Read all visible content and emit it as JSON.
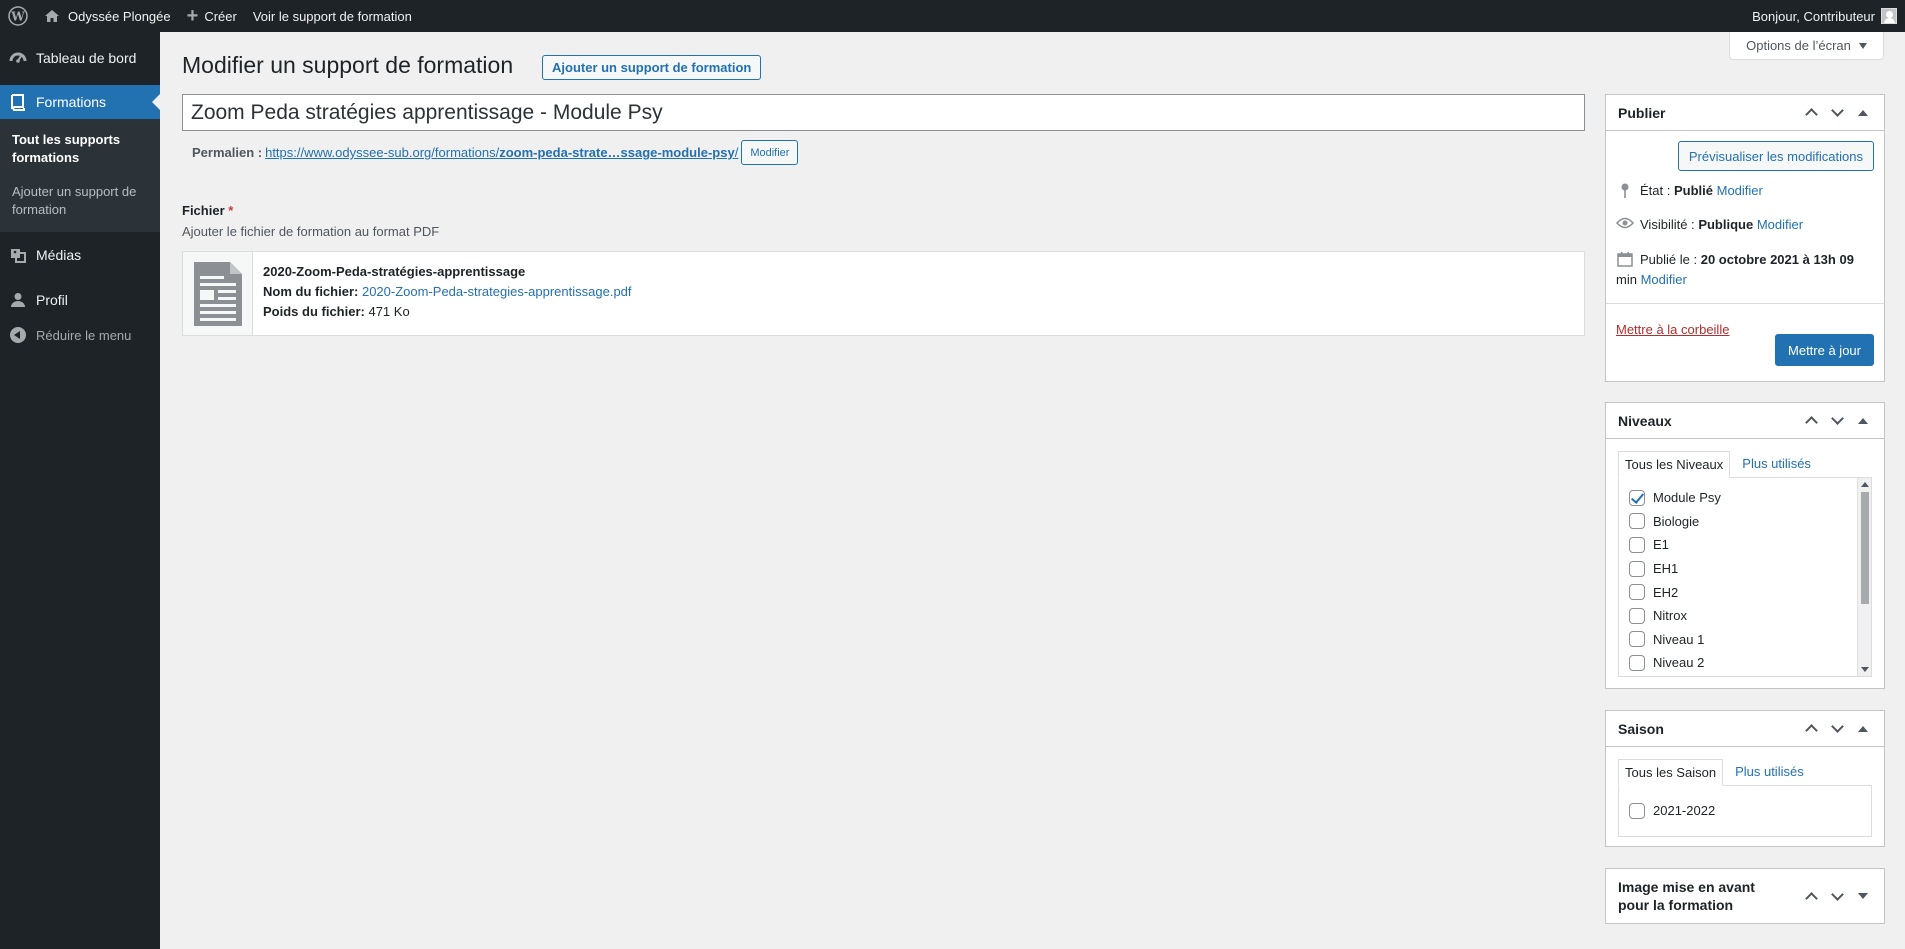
{
  "admin_bar": {
    "site_name": "Odyssée Plongée",
    "new_label": "Créer",
    "view_label": "Voir le support de formation",
    "greeting": "Bonjour, Contributeur"
  },
  "sidebar": {
    "items": [
      {
        "label": "Tableau de bord",
        "icon": "dashboard-icon"
      },
      {
        "label": "Formations",
        "icon": "book-icon"
      },
      {
        "label": "Médias",
        "icon": "media-icon"
      },
      {
        "label": "Profil",
        "icon": "user-icon"
      }
    ],
    "submenu": [
      {
        "label": "Tout les supports formations"
      },
      {
        "label": "Ajouter un support de formation"
      }
    ],
    "collapse_label": "Réduire le menu"
  },
  "screen_options": "Options de l’écran",
  "page": {
    "title": "Modifier un support de formation",
    "add_new": "Ajouter un support de formation",
    "post_title": "Zoom Peda stratégies apprentissage - Module Psy",
    "permalink_label": "Permalien :",
    "permalink_base": "https://www.odyssee-sub.org/formations/",
    "permalink_slug": "zoom-peda-strate…ssage-module-psy",
    "permalink_end": "/",
    "permalink_edit": "Modifier"
  },
  "file_field": {
    "label": "Fichier",
    "required_mark": "*",
    "description": "Ajouter le fichier de formation au format PDF",
    "title": "2020-Zoom-Peda-stratégies-apprentissage",
    "name_label": "Nom du fichier:",
    "name_value": "2020-Zoom-Peda-strategies-apprentissage.pdf",
    "size_label": "Poids du fichier:",
    "size_value": "471 Ko"
  },
  "publish": {
    "title": "Publier",
    "preview": "Prévisualiser les modifications",
    "status_label": "État :",
    "status_value": "Publié",
    "visibility_label": "Visibilité :",
    "visibility_value": "Publique",
    "published_label": "Publié le :",
    "published_value": "20 octobre 2021 à 13h 09",
    "published_value_end": "min",
    "edit": "Modifier",
    "trash": "Mettre à la corbeille",
    "update": "Mettre à jour"
  },
  "niveaux": {
    "title": "Niveaux",
    "tab_all": "Tous les Niveaux",
    "tab_popular": "Plus utilisés",
    "items": [
      {
        "label": "Module Psy",
        "checked": true
      },
      {
        "label": "Biologie",
        "checked": false
      },
      {
        "label": "E1",
        "checked": false
      },
      {
        "label": "EH1",
        "checked": false
      },
      {
        "label": "EH2",
        "checked": false
      },
      {
        "label": "Nitrox",
        "checked": false
      },
      {
        "label": "Niveau 1",
        "checked": false
      },
      {
        "label": "Niveau 2",
        "checked": false
      }
    ]
  },
  "saison": {
    "title": "Saison",
    "tab_all": "Tous les Saison",
    "tab_popular": "Plus utilisés",
    "items": [
      {
        "label": "2021-2022",
        "checked": false
      }
    ]
  },
  "featured_image": {
    "title_line1": "Image mise en avant",
    "title_line2": "pour la formation"
  }
}
